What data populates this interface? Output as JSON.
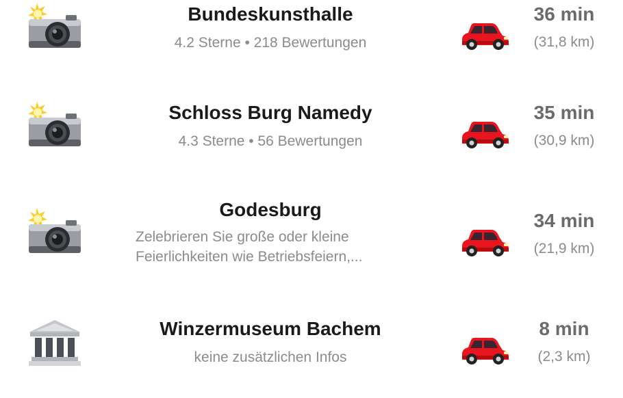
{
  "places": [
    {
      "icon": "camera-flash-icon",
      "name": "Bundeskunsthalle",
      "details": "4.2 Sterne • 218 Bewertungen",
      "travel_icon": "car-icon",
      "duration": "36 min",
      "distance": "(31,8 km)"
    },
    {
      "icon": "camera-flash-icon",
      "name": "Schloss Burg Namedy",
      "details": "4.3 Sterne • 56 Bewertungen",
      "travel_icon": "car-icon",
      "duration": "35 min",
      "distance": "(30,9 km)"
    },
    {
      "icon": "camera-flash-icon",
      "name": "Godesburg",
      "details_line1": "Zelebrieren Sie große oder kleine",
      "details_line2": "Feierlichkeiten wie Betriebsfeiern,...",
      "travel_icon": "car-icon",
      "duration": "34 min",
      "distance": "(21,9 km)"
    },
    {
      "icon": "museum-icon",
      "name": "Winzermuseum Bachem",
      "details": "keine zusätzlichen Infos",
      "travel_icon": "car-icon",
      "duration": "8 min",
      "distance": "(2,3 km)"
    }
  ],
  "colors": {
    "title": "#1a1a1a",
    "subtitle": "#8b8b8b",
    "duration": "#6b6b6b",
    "car": "#e8141e"
  }
}
